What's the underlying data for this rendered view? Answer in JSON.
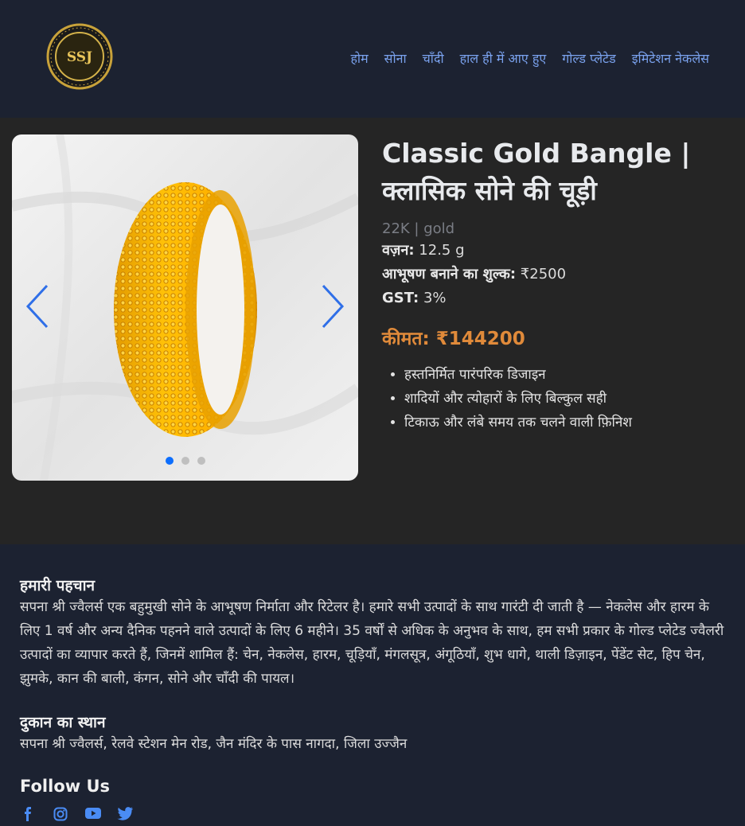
{
  "logo": {
    "text": "SSJ",
    "ring_text": "SAPNA SHRI JEWELLERS",
    "city": "NAGDA"
  },
  "nav": {
    "items": [
      "होम",
      "सोना",
      "चाँदी",
      "हाल ही में आए हुए",
      "गोल्ड प्लेटेड",
      "इमिटेशन नेकलेस"
    ]
  },
  "product": {
    "title": "Classic Gold Bangle | क्लासिक सोने की चूड़ी",
    "subtitle": "22K | gold",
    "weight_label": "वज़न:",
    "weight_value": "12.5 g",
    "making_label": "आभूषण बनाने का शुल्क:",
    "making_value": "₹2500",
    "gst_label": "GST:",
    "gst_value": "3%",
    "price_label": "कीमत:",
    "price_value": "₹144200",
    "features": [
      "हस्तनिर्मित पारंपरिक डिजाइन",
      "शादियों और त्योहारों के लिए बिल्कुल सही",
      "टिकाऊ और लंबे समय तक चलने वाली फ़िनिश"
    ],
    "carousel": {
      "slides": 3,
      "active": 1
    }
  },
  "footer": {
    "about_title": "हमारी पहचान",
    "about_text": "सपना श्री ज्वैलर्स एक बहुमुखी सोने के आभूषण निर्माता और रिटेलर है। हमारे सभी उत्पादों के साथ गारंटी दी जाती है — नेकलेस और हारम के लिए 1 वर्ष और अन्य दैनिक पहनने वाले उत्पादों के लिए 6 महीने। 35 वर्षों से अधिक के अनुभव के साथ, हम सभी प्रकार के गोल्ड प्लेटेड ज्वैलरी उत्पादों का व्यापार करते हैं, जिनमें शामिल हैं: चेन, नेकलेस, हारम, चूड़ियाँ, मंगलसूत्र, अंगूठियाँ, शुभ धागे, थाली डिज़ाइन, पेंडेंट सेट, हिप चेन, झुमके, कान की बाली, कंगन, सोने और चाँदी की पायल।",
    "location_title": "दुकान का स्थान",
    "location_text": "सपना श्री ज्वैलर्स, रेलवे स्टेशन मेन रोड, जैन मंदिर के पास नागदा, जिला उज्जैन",
    "follow_title": "Follow Us",
    "social": [
      "facebook-icon",
      "instagram-icon",
      "youtube-icon",
      "twitter-icon"
    ]
  },
  "colors": {
    "accent": "#7aa2ee",
    "price": "#e08a3a",
    "header_bg": "#1c2231",
    "body_bg": "#252525"
  }
}
